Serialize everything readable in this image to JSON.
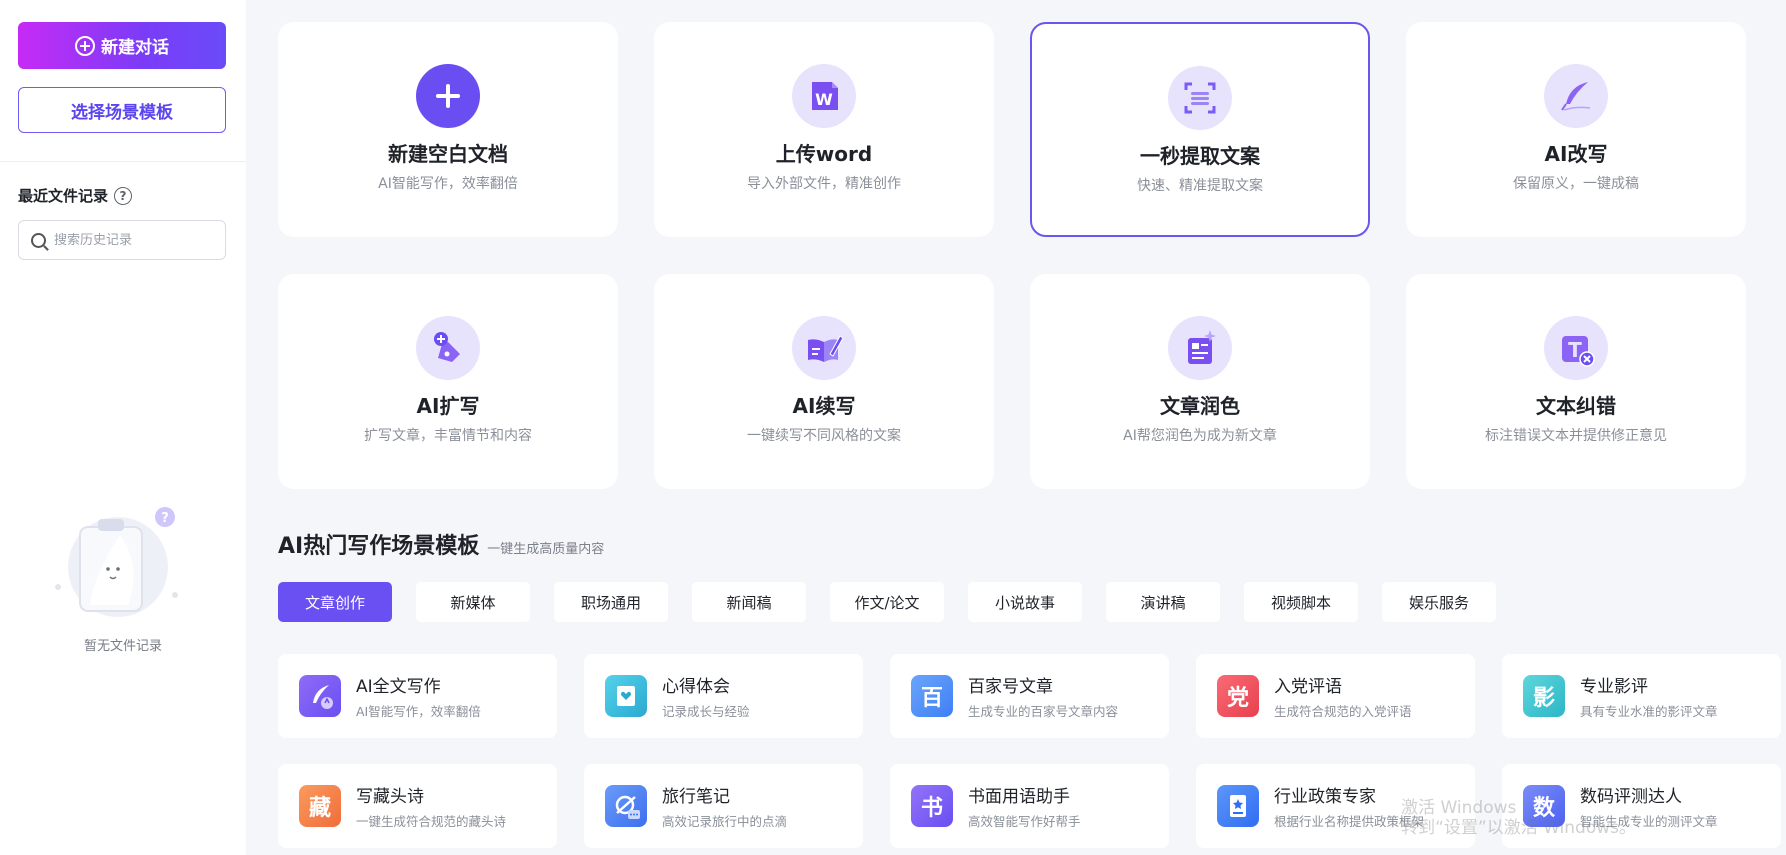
{
  "sidebar": {
    "new_chat_label": "新建对话",
    "template_label": "选择场景模板",
    "recent_title": "最近文件记录",
    "help_glyph": "?",
    "search_placeholder": "搜索历史记录",
    "empty_text": "暂无文件记录"
  },
  "tools": [
    {
      "title": "新建空白文档",
      "sub": "AI智能写作，效率翻倍",
      "icon": "plus-icon"
    },
    {
      "title": "上传word",
      "sub": "导入外部文件，精准创作",
      "icon": "word-file-icon"
    },
    {
      "title": "一秒提取文案",
      "sub": "快速、精准提取文案",
      "icon": "scan-text-icon"
    },
    {
      "title": "AI改写",
      "sub": "保留原义，一键成稿",
      "icon": "quill-icon"
    },
    {
      "title": "AI扩写",
      "sub": "扩写文章，丰富情节和内容",
      "icon": "pen-plus-icon"
    },
    {
      "title": "AI续写",
      "sub": "一键续写不同风格的文案",
      "icon": "book-pen-icon"
    },
    {
      "title": "文章润色",
      "sub": "AI帮您润色为成为新文章",
      "icon": "document-sparkle-icon"
    },
    {
      "title": "文本纠错",
      "sub": "标注错误文本并提供修正意见",
      "icon": "text-correct-icon"
    }
  ],
  "section": {
    "title": "AI热门写作场景模板",
    "subtitle": "一键生成高质量内容"
  },
  "categories": [
    "文章创作",
    "新媒体",
    "职场通用",
    "新闻稿",
    "作文/论文",
    "小说故事",
    "演讲稿",
    "视频脚本",
    "娱乐服务"
  ],
  "templates": [
    {
      "title": "AI全文写作",
      "desc": "AI智能写作，效率翻倍",
      "glyph": "",
      "icon": "ai-quill-icon",
      "color": "#7b5cf5"
    },
    {
      "title": "心得体会",
      "desc": "记录成长与经验",
      "glyph": "",
      "icon": "heart-book-icon",
      "color": "#33bfdc"
    },
    {
      "title": "百家号文章",
      "desc": "生成专业的百家号文章内容",
      "glyph": "百",
      "icon": "baijia-icon",
      "color": "#4f8ff7"
    },
    {
      "title": "入党评语",
      "desc": "生成符合规范的入党评语",
      "glyph": "党",
      "icon": "party-icon",
      "color": "#f0505c"
    },
    {
      "title": "专业影评",
      "desc": "具有专业水准的影评文章",
      "glyph": "影",
      "icon": "film-icon",
      "color": "#3ec6d6"
    },
    {
      "title": "写藏头诗",
      "desc": "一键生成符合规范的藏头诗",
      "glyph": "藏",
      "icon": "poem-icon",
      "color": "#f7854a"
    },
    {
      "title": "旅行笔记",
      "desc": "高效记录旅行中的点滴",
      "glyph": "",
      "icon": "travel-icon",
      "color": "#4f82f5"
    },
    {
      "title": "书面用语助手",
      "desc": "高效智能写作好帮手",
      "glyph": "书",
      "icon": "book-icon",
      "color": "#7a5af5"
    },
    {
      "title": "行业政策专家",
      "desc": "根据行业名称提供政策框架",
      "glyph": "",
      "icon": "policy-icon",
      "color": "#3f83f5"
    },
    {
      "title": "数码评测达人",
      "desc": "智能生成专业的测评文章",
      "glyph": "数",
      "icon": "digital-icon",
      "color": "#5b6ff5"
    }
  ],
  "watermark": {
    "line1": "激活 Windows",
    "line2": "转到“设置”以激活 Windows。"
  },
  "colors": {
    "accent": "#6a50f2",
    "gradient_start": "#c62bf5",
    "icon_bg": "#e8e3fd",
    "icon_fg": "#7a5cf5"
  }
}
